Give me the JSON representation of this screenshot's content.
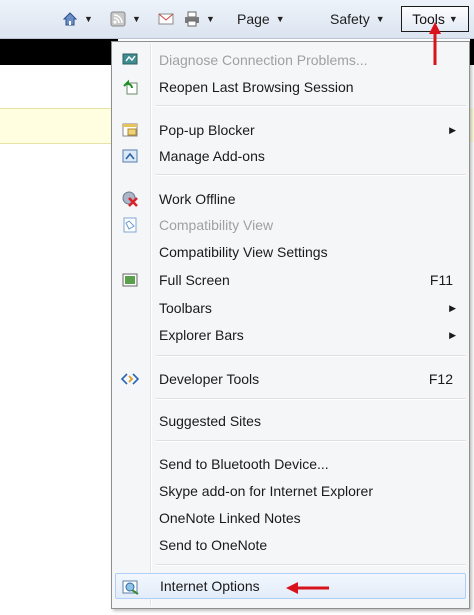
{
  "toolbar": {
    "page_label": "Page",
    "safety_label": "Safety",
    "tools_label": "Tools"
  },
  "menu": {
    "items": [
      {
        "label": "Diagnose Connection Problems...",
        "icon": "diagnose-icon",
        "disabled": true
      },
      {
        "label": "Reopen Last Browsing Session",
        "icon": "reopen-icon"
      },
      {
        "label": "Pop-up Blocker",
        "icon": "popup-blocker-icon",
        "submenu": true
      },
      {
        "label": "Manage Add-ons",
        "icon": "manage-addons-icon"
      },
      {
        "label": "Work Offline",
        "icon": "work-offline-icon"
      },
      {
        "label": "Compatibility View",
        "icon": "compatibility-view-icon",
        "disabled": true
      },
      {
        "label": "Compatibility View Settings"
      },
      {
        "label": "Full Screen",
        "icon": "full-screen-icon",
        "shortcut": "F11"
      },
      {
        "label": "Toolbars",
        "submenu": true
      },
      {
        "label": "Explorer Bars",
        "submenu": true
      },
      {
        "label": "Developer Tools",
        "icon": "developer-tools-icon",
        "shortcut": "F12"
      },
      {
        "label": "Suggested Sites"
      },
      {
        "label": "Send to Bluetooth Device..."
      },
      {
        "label": "Skype add-on for Internet Explorer"
      },
      {
        "label": "OneNote Linked Notes"
      },
      {
        "label": "Send to OneNote"
      },
      {
        "label": "Internet Options",
        "icon": "internet-options-icon",
        "highlighted": true
      }
    ]
  },
  "colors": {
    "annotation_arrow": "#d9131b",
    "highlight_border": "#aecff7"
  }
}
